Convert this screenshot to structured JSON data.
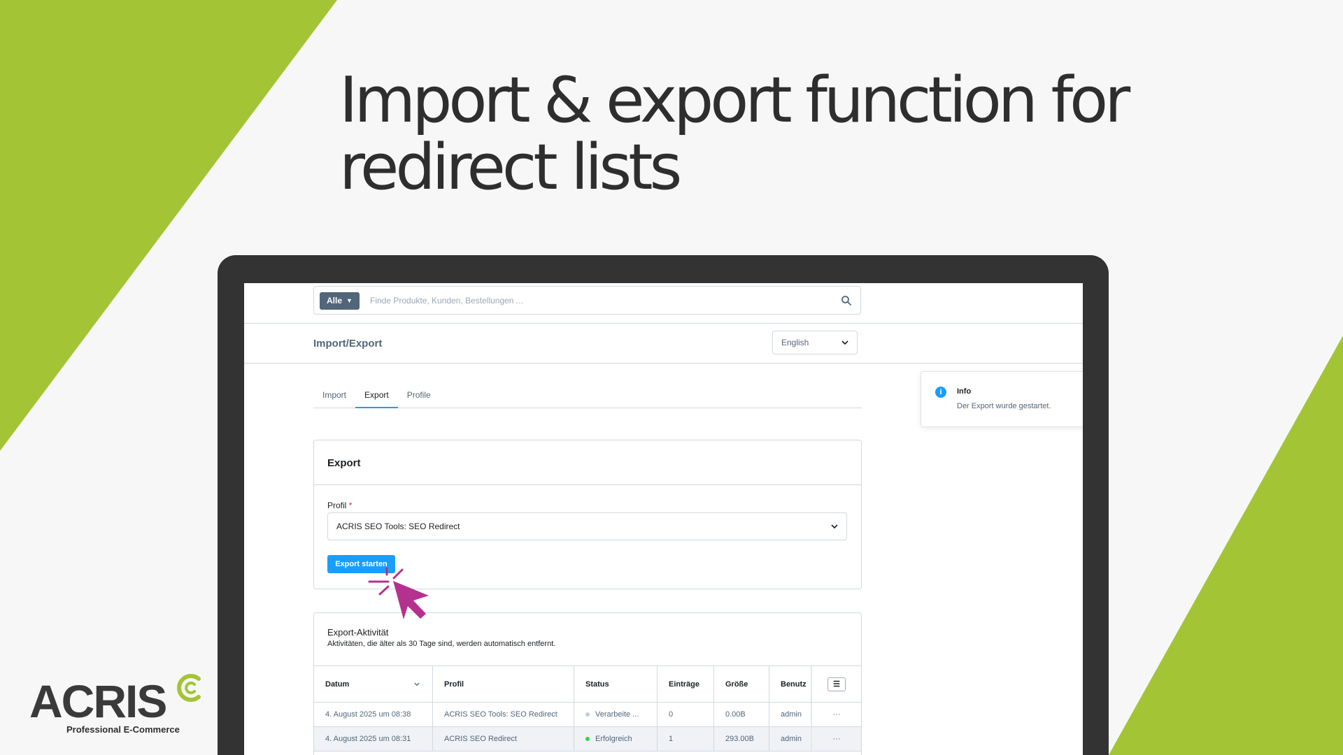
{
  "headline": "Import & export function for redirect lists",
  "colors": {
    "brand_green": "#a3c535",
    "accent_blue": "#189eff",
    "cursor_magenta": "#b5318f"
  },
  "search": {
    "type_label": "Alle",
    "placeholder": "Finde Produkte, Kunden, Bestellungen ..."
  },
  "header": {
    "title": "Import/Export",
    "language": "English"
  },
  "tabs": [
    {
      "label": "Import"
    },
    {
      "label": "Export",
      "active": true
    },
    {
      "label": "Profile"
    }
  ],
  "export_card": {
    "title": "Export",
    "profile_label": "Profil",
    "required_mark": "*",
    "profile_value": "ACRIS SEO Tools: SEO Redirect",
    "button_label": "Export starten"
  },
  "activity": {
    "title": "Export-Aktivität",
    "subtitle": "Aktivitäten, die älter als 30 Tage sind, werden automatisch entfernt.",
    "columns": [
      "Datum",
      "Profil",
      "Status",
      "Einträge",
      "Größe",
      "Benutz"
    ],
    "rows": [
      {
        "date": "4. August 2025 um 08:38",
        "profile": "ACRIS SEO Tools: SEO Redirect",
        "status": "Verarbeite ...",
        "status_color": "#c4cdd6",
        "entries": "0",
        "size": "0.00B",
        "user": "admin",
        "actions": "···"
      },
      {
        "date": "4. August 2025 um 08:31",
        "profile": "ACRIS SEO Redirect",
        "status": "Erfolgreich",
        "status_color": "#37d046",
        "entries": "1",
        "size": "293.00B",
        "user": "admin",
        "actions": "···"
      }
    ]
  },
  "notification": {
    "title": "Info",
    "message": "Der Export wurde gestartet."
  },
  "logo": {
    "text": "ACRIS",
    "tagline": "Professional E-Commerce"
  },
  "icons": {
    "search": "search-icon",
    "chevron": "chevron-down-icon",
    "info": "info-icon",
    "settings": "list-settings-icon",
    "cursor": "cursor-click-icon"
  }
}
